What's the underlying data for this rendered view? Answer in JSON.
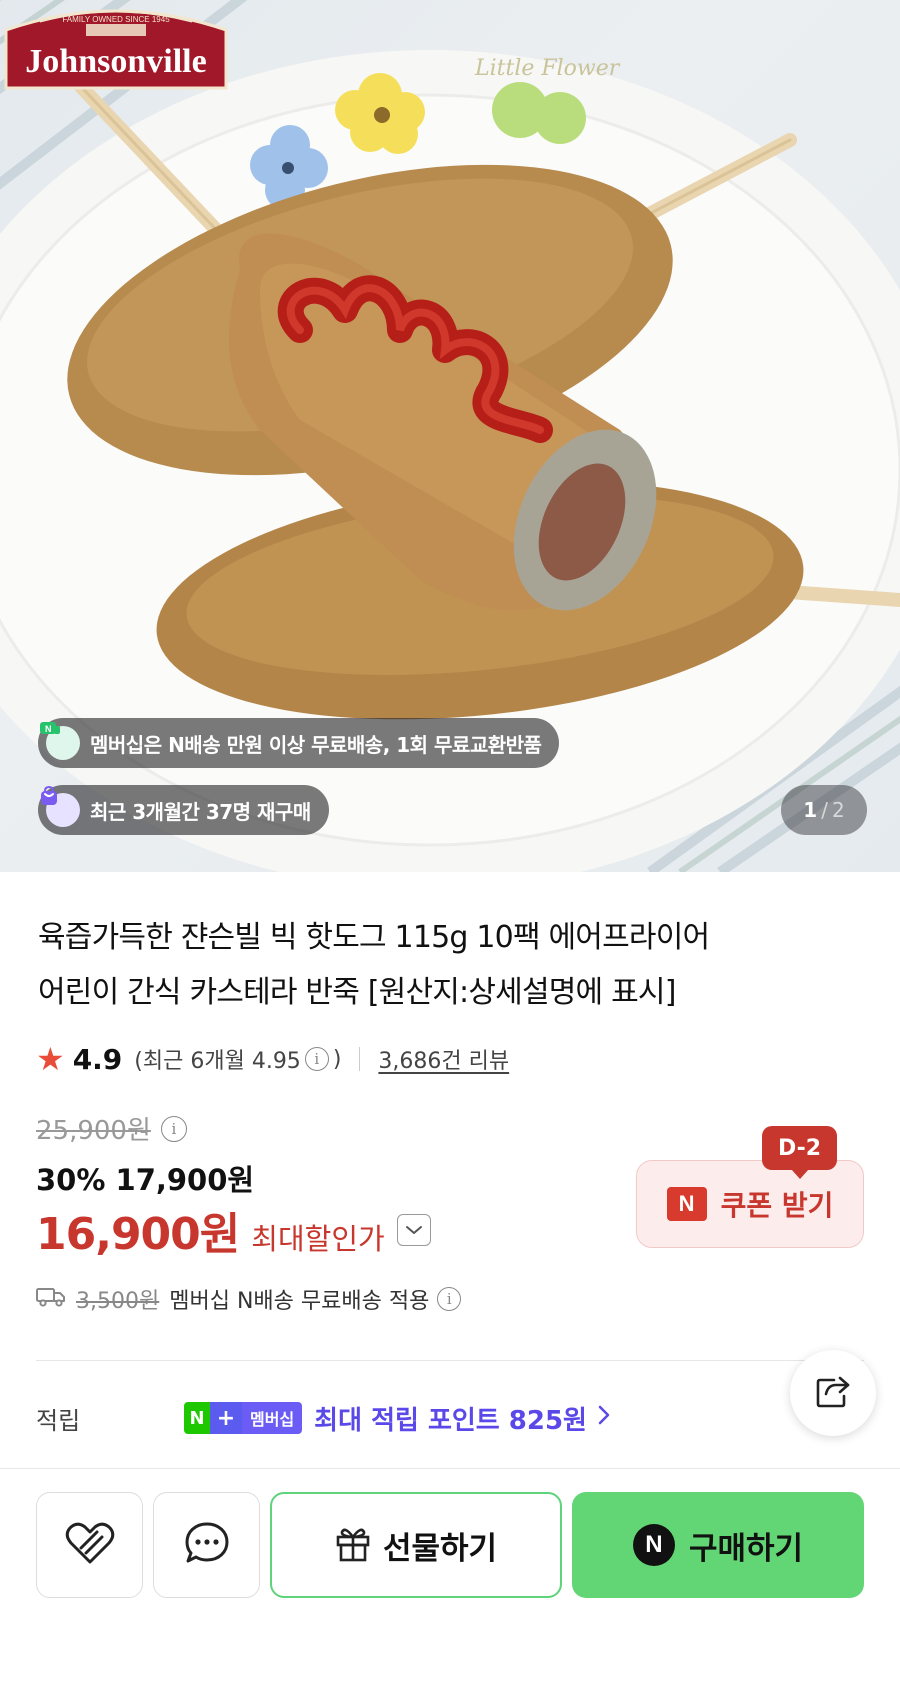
{
  "hero": {
    "brand_logo_text": "Johnsonville",
    "brand_logo_subtext": "FAMILY OWNED SINCE 1945",
    "plate_text": "Little Flower",
    "membership_pill": "멤버십은 N배송 만원 이상 무료배송, 1회 무료교환반품",
    "repurchase_pill": "최근 3개월간 37명 재구매",
    "pager_current": "1",
    "pager_separator": "/",
    "pager_total": "2"
  },
  "product": {
    "title_line1": "육즙가득한 쟌슨빌 빅 핫도그 115g 10팩 에어프라이어",
    "title_line2": "어린이 간식 카스테라 반죽 [원산지:상세설명에 표시]",
    "rating_value": "4.9",
    "rating_recent_open": "(최근 6개월 4.95",
    "rating_recent_close": ")",
    "review_count": "3,686건 리뷰"
  },
  "price": {
    "original": "25,900원",
    "sale": "30% 17,900원",
    "final": "16,900원",
    "final_label": "최대할인가",
    "coupon_dday": "D-2",
    "coupon_label": "쿠폰 받기",
    "coupon_n": "N"
  },
  "shipping": {
    "old_fee": "3,500원",
    "text": "멤버십 N배송 무료배송 적용"
  },
  "points": {
    "label": "적립",
    "badge_n": "N",
    "badge_plus": "+",
    "badge_membership": "멤버십",
    "text": "최대 적립 포인트 825원"
  },
  "actions": {
    "gift_label": "선물하기",
    "buy_label": "구매하기",
    "buy_n": "N"
  },
  "colors": {
    "accent_red": "#c8372d",
    "naver_green": "#62d675",
    "membership_purple": "#5a48e8"
  }
}
